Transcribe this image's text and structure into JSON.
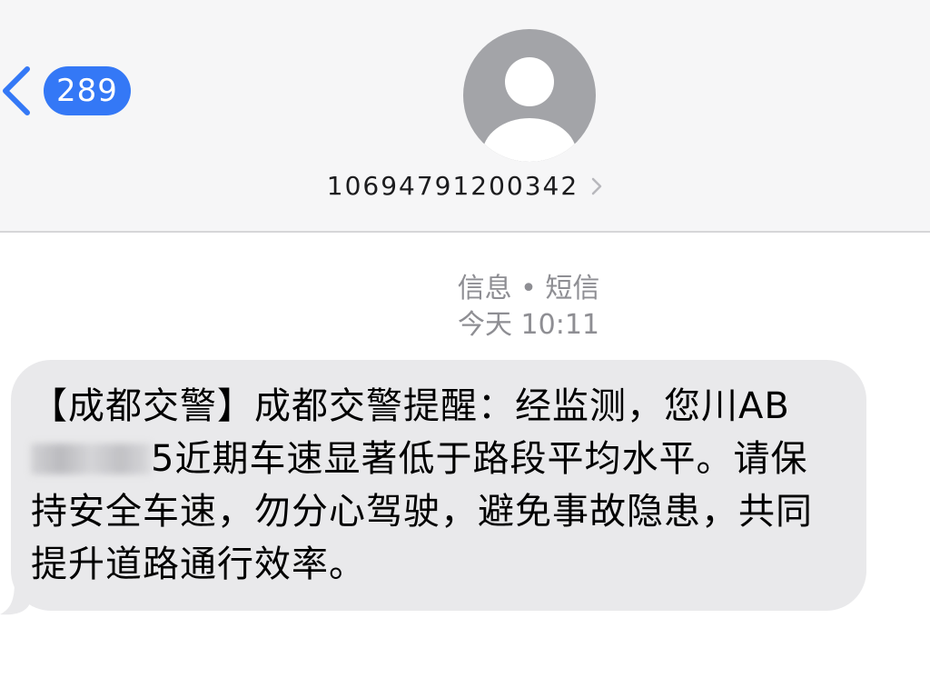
{
  "nav": {
    "back_icon": "chevron-left-icon",
    "unread_count": "289"
  },
  "contact": {
    "avatar_icon": "person-placeholder-icon",
    "number": "10694791200342",
    "detail_icon": "chevron-right-icon"
  },
  "thread": {
    "service": "信息 • 短信",
    "time": "今天 10:11"
  },
  "message": {
    "text_before_plate": "【成都交警】成都交警提醒：经监测，您川AB",
    "plate_redacted": "[redacted]",
    "text_after_plate": "5近期车速显著低于路段平均水平。请保持安全车速，勿分心驾驶，避免事故隐患，共同提升道路通行效率。",
    "bubble_color": "#e9e9eb"
  },
  "colors": {
    "accent": "#3478f6",
    "header_bg": "#f6f6f7",
    "secondary_text": "#8e8e93",
    "avatar": "#a3a4a8"
  }
}
